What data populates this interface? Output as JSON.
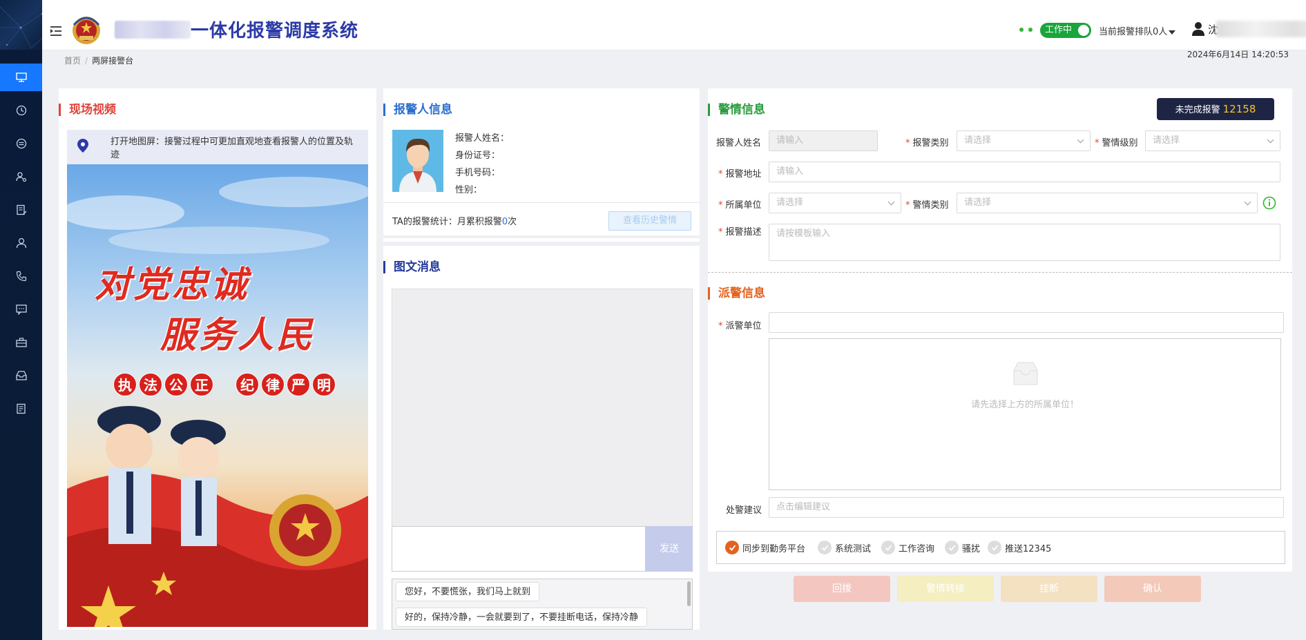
{
  "header": {
    "app_title": "一体化报警调度系统",
    "work_status": "工作中",
    "queue_text": "当前报警排队0人",
    "user_name": "沈"
  },
  "breadcrumb": {
    "home": "首页",
    "separator": "/",
    "current": "两屏接警台"
  },
  "datetime": "2024年6月14日 14:20:53",
  "sidebar": {
    "items": [
      {
        "icon": "monitor-icon",
        "active": true
      },
      {
        "icon": "history-icon",
        "active": false
      },
      {
        "icon": "exchange-icon",
        "active": false
      },
      {
        "icon": "user-settings-icon",
        "active": false
      },
      {
        "icon": "report-edit-icon",
        "active": false
      },
      {
        "icon": "person-icon",
        "active": false
      },
      {
        "icon": "phone-icon",
        "active": false
      },
      {
        "icon": "message-icon",
        "active": false
      },
      {
        "icon": "briefcase-icon",
        "active": false
      },
      {
        "icon": "inbox-icon",
        "active": false
      },
      {
        "icon": "document-edit-icon",
        "active": false
      }
    ]
  },
  "video_panel": {
    "title": "现场视频",
    "map_tip": "打开地图屏：接警过程中可更加直观地查看报警人的位置及轨迹",
    "poster": {
      "slogan_line1": "对党忠诚",
      "slogan_line2": "服务人民",
      "motto_left": [
        "执",
        "法",
        "公",
        "正"
      ],
      "motto_right": [
        "纪",
        "律",
        "严",
        "明"
      ]
    }
  },
  "reporter_panel": {
    "title": "报警人信息",
    "name_label": "报警人姓名：",
    "id_label": "身份证号：",
    "phone_label": "手机号码：",
    "gender_label": "性别：",
    "stats_prefix": "TA的报警统计：月累积报警",
    "stats_count": "0",
    "stats_suffix": "次",
    "history_button": "查看历史警情"
  },
  "message_panel": {
    "title": "图文消息",
    "send_button": "发送",
    "quick_replies": [
      "您好，不要慌张，我们马上就到",
      "好的，保持冷静，一会就要到了，不要挂断电话，保持冷静"
    ]
  },
  "alarm_panel": {
    "title": "警情信息",
    "incomplete_label": "未完成报警",
    "incomplete_count": "12158",
    "fields": {
      "reporter_name_label": "报警人姓名",
      "reporter_name_placeholder": "请输入",
      "report_type_label": "报警类别",
      "report_type_placeholder": "请选择",
      "alarm_level_label": "警情级别",
      "alarm_level_placeholder": "请选择",
      "address_label": "报警地址",
      "address_placeholder": "请输入",
      "unit_label": "所属单位",
      "unit_placeholder": "请选择",
      "alarm_type_label": "警情类别",
      "alarm_type_placeholder": "请选择",
      "description_label": "报警描述",
      "description_placeholder": "请按模板输入"
    }
  },
  "dispatch_panel": {
    "title": "派警信息",
    "unit_label": "派警单位",
    "empty_message": "请先选择上方的所属单位！",
    "suggestion_label": "处警建议",
    "suggestion_placeholder": "点击编辑建议",
    "options": [
      {
        "label": "同步到勤务平台",
        "checked": true
      },
      {
        "label": "系统测试",
        "checked": false
      },
      {
        "label": "工作咨询",
        "checked": false
      },
      {
        "label": "骚扰",
        "checked": false
      },
      {
        "label": "推送12345",
        "checked": false
      }
    ]
  },
  "actions": {
    "callback": "回拨",
    "transfer": "警情转接",
    "hangup": "挂断",
    "confirm": "确认"
  },
  "colors": {
    "primary_blue": "#1677ff",
    "title_navy": "#2b3aa8",
    "accent_red": "#e0433b",
    "accent_green": "#2a9c3e",
    "accent_orange": "#e2631f",
    "callback_btn": "#f3c7c0",
    "transfer_btn": "#f4eec0",
    "hangup_btn": "#f4e1c2",
    "confirm_btn": "#f3c9b9"
  }
}
